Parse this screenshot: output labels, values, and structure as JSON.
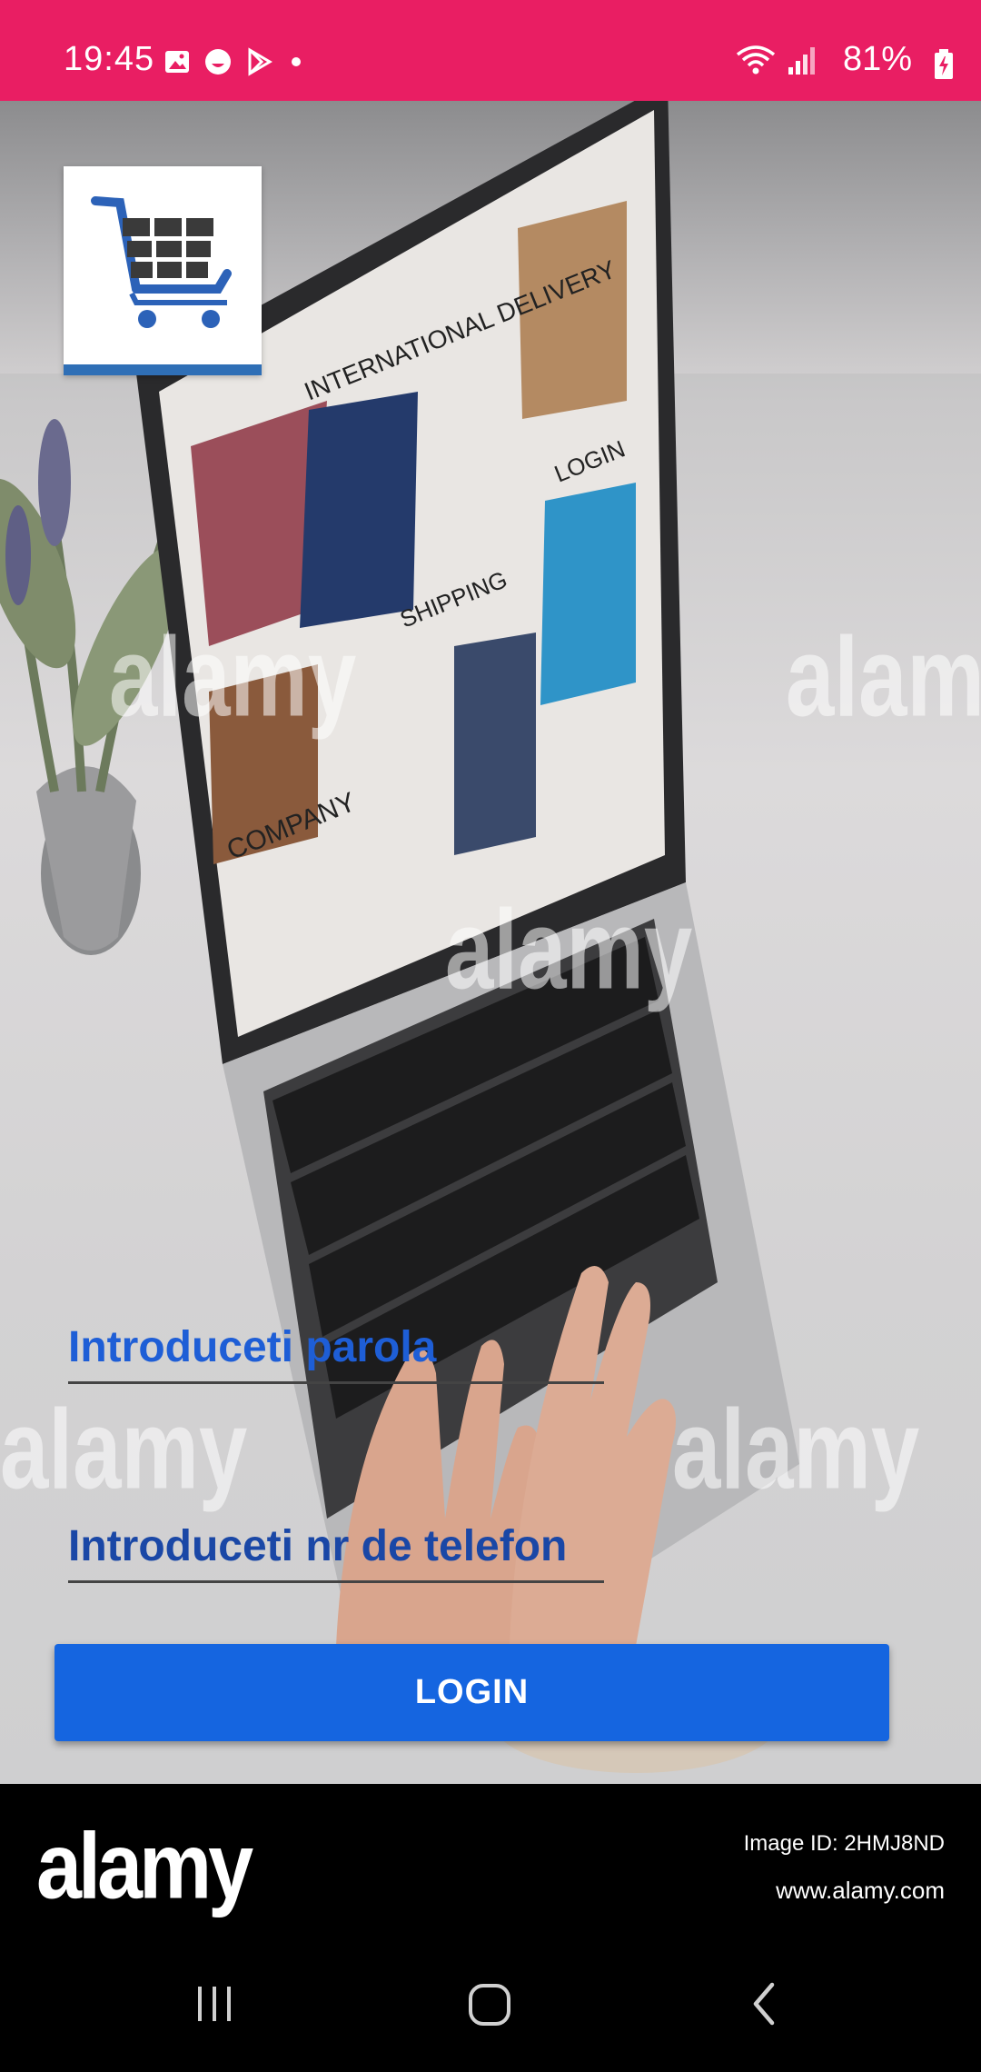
{
  "status_bar": {
    "time": "19:45",
    "battery": "81%",
    "color": "#E91E63",
    "icons": [
      "image-icon",
      "face-icon",
      "play-store-icon",
      "dot-icon",
      "wifi-icon",
      "signal-icon",
      "battery-charging-icon"
    ]
  },
  "screen_laptop_labels": [
    "INTERNATIONAL DELIVERY",
    "LOGIN",
    "SHIPPING",
    "COMPANY"
  ],
  "watermark": "alamy",
  "form": {
    "password_placeholder": "Introduceti parola",
    "phone_placeholder": "Introduceti nr de telefon",
    "login_label": "LOGIN",
    "accent": "#1565E0"
  },
  "footer": {
    "brand": "alamy",
    "image_id": "Image ID: 2HMJ8ND",
    "site": "www.alamy.com"
  },
  "nav": [
    "recent-apps-icon",
    "home-icon",
    "back-icon"
  ]
}
